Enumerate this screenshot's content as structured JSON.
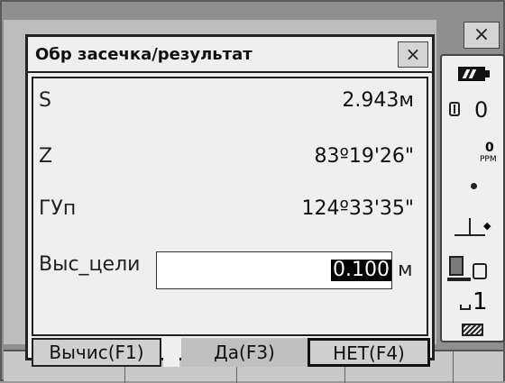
{
  "dialog": {
    "title": "Обр засечка/результат",
    "rows": [
      {
        "label": "S",
        "value": "2.943м"
      },
      {
        "label": "Z",
        "value": "83º19'26\""
      },
      {
        "label": "ГУп",
        "value": "124º33'35\""
      }
    ],
    "input": {
      "label": "Выс_цели",
      "value": "0.100",
      "unit": "м"
    },
    "buttons": [
      "Вычис(F1)",
      "Да(F3)",
      "НЕТ(F4)"
    ]
  },
  "status": {
    "prism_constant": "0",
    "ppm_value": "0",
    "ppm_label": "PPM",
    "page_number": "1"
  },
  "icons": [
    "close-icon",
    "battery-icon",
    "prism-icon",
    "ppm-icon",
    "tilt-dot-icon",
    "laser-plummet-icon",
    "instrument-icon",
    "page-icon",
    "input-mode-icon"
  ]
}
